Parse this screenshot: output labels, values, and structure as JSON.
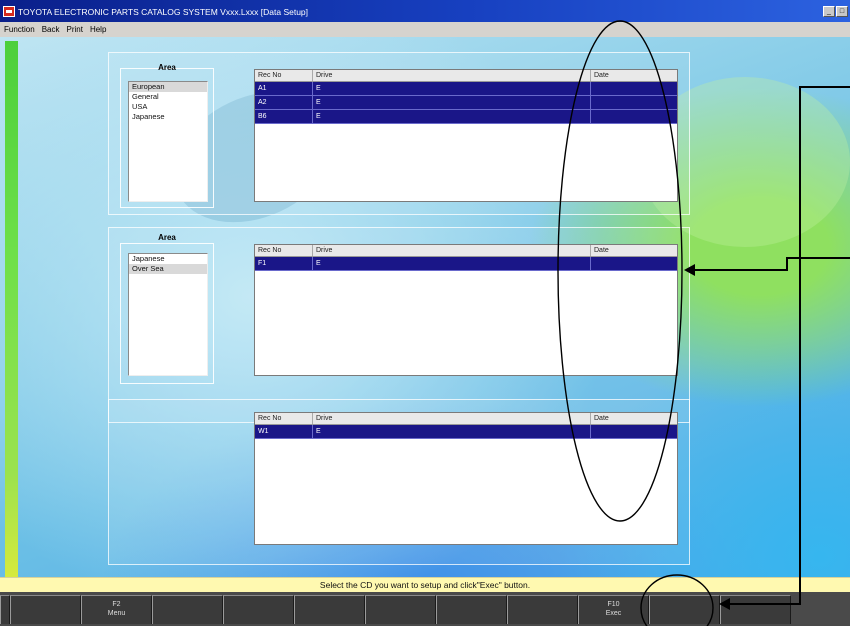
{
  "window": {
    "title": "TOYOTA ELECTRONIC PARTS CATALOG SYSTEM Vxxx.Lxxx [Data Setup]",
    "controls": [
      "_",
      "□"
    ]
  },
  "menu": {
    "items": [
      "Function",
      "Back",
      "Print",
      "Help"
    ]
  },
  "sections": [
    {
      "area_title": "Area",
      "area_options": [
        "European",
        "General",
        "USA",
        "Japanese"
      ],
      "area_selected_index": 0,
      "columns": [
        "Rec No",
        "Drive",
        "Date"
      ],
      "rows": [
        {
          "rec_no": "A1",
          "drive": "E",
          "date": ""
        },
        {
          "rec_no": "A2",
          "drive": "E",
          "date": ""
        },
        {
          "rec_no": "B6",
          "drive": "E",
          "date": ""
        }
      ]
    },
    {
      "area_title": "Area",
      "area_options": [
        "Japanese",
        "Over Sea"
      ],
      "area_selected_index": 1,
      "columns": [
        "Rec No",
        "Drive",
        "Date"
      ],
      "rows": [
        {
          "rec_no": "F1",
          "drive": "E",
          "date": ""
        }
      ]
    },
    {
      "area_title": "",
      "area_options": [],
      "columns": [
        "Rec No",
        "Drive",
        "Date"
      ],
      "rows": [
        {
          "rec_no": "W1",
          "drive": "E",
          "date": ""
        }
      ]
    }
  ],
  "status": {
    "message": "Select the CD you want to setup and click\"Exec\" button."
  },
  "function_keys": [
    {
      "key": "",
      "label": ""
    },
    {
      "key": "F2",
      "label": "Menu"
    },
    {
      "key": "",
      "label": ""
    },
    {
      "key": "",
      "label": ""
    },
    {
      "key": "",
      "label": ""
    },
    {
      "key": "",
      "label": ""
    },
    {
      "key": "",
      "label": ""
    },
    {
      "key": "",
      "label": ""
    },
    {
      "key": "",
      "label": ""
    },
    {
      "key": "F10",
      "label": "Exec"
    },
    {
      "key": "",
      "label": ""
    },
    {
      "key": "",
      "label": ""
    }
  ],
  "annotation": {
    "color": "#000000"
  }
}
